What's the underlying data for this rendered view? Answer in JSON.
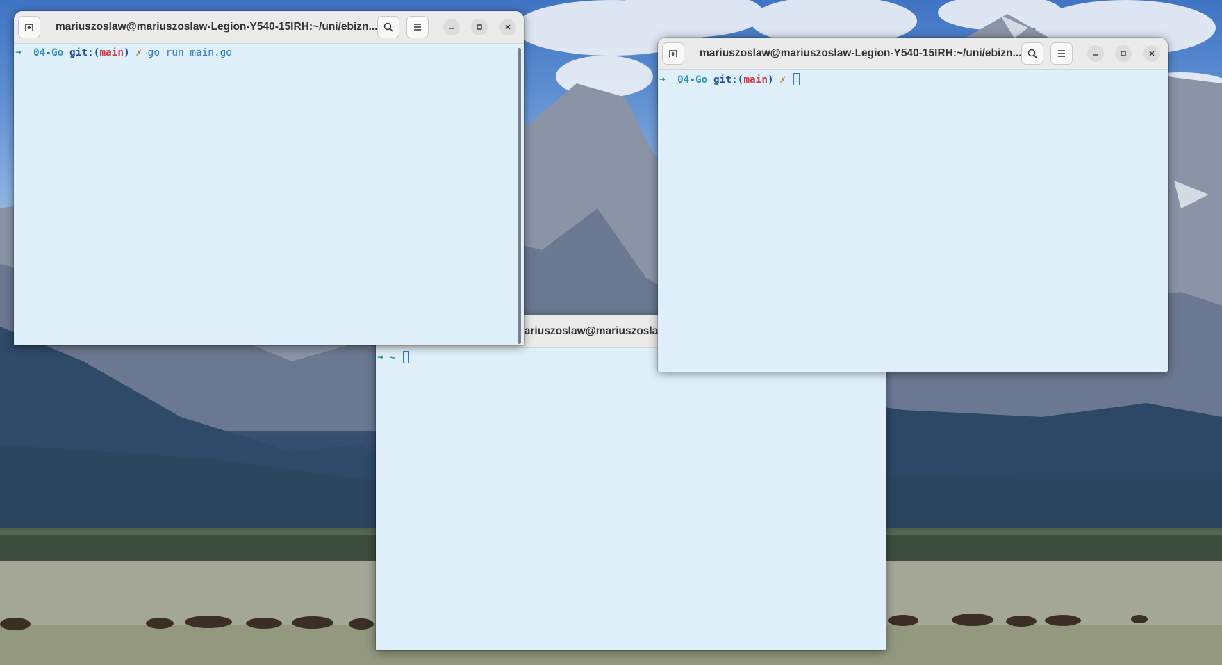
{
  "theme": {
    "terminal_bg": "#e0f0fb",
    "titlebar_bg": "#ebebeb",
    "prompt_arrow": "#1f8f6a",
    "prompt_dir": "#2e8fb0",
    "git_label": "#1c4f9c",
    "branch": "#d0343e",
    "dirty_mark": "#b8862e",
    "command": "#2d79c7"
  },
  "windows": {
    "left": {
      "title": "mariuszoslaw@mariuszoslaw-Legion-Y540-15IRH:~/uni/ebizn...",
      "prompt": {
        "arrow": "➜",
        "dir": "04-Go",
        "git_open": "git:(",
        "branch": "main",
        "git_close": ")",
        "dirty": "✗",
        "command": "go run main.go"
      },
      "icons": {
        "new_tab": "new-tab-icon",
        "search": "search-icon",
        "menu": "hamburger-menu-icon",
        "minimize": "minimize-icon",
        "maximize": "maximize-icon",
        "close": "close-icon"
      }
    },
    "middle": {
      "title": "mariuszoslaw@mariuszoslaw-Legion",
      "prompt": {
        "arrow": "➜",
        "dir": "~"
      }
    },
    "right": {
      "title": "mariuszoslaw@mariuszoslaw-Legion-Y540-15IRH:~/uni/ebizn...",
      "prompt": {
        "arrow": "➜",
        "dir": "04-Go",
        "git_open": "git:(",
        "branch": "main",
        "git_close": ")",
        "dirty": "✗"
      },
      "icons": {
        "new_tab": "new-tab-icon",
        "search": "search-icon",
        "menu": "hamburger-menu-icon",
        "minimize": "minimize-icon",
        "maximize": "maximize-icon",
        "close": "close-icon"
      }
    }
  }
}
